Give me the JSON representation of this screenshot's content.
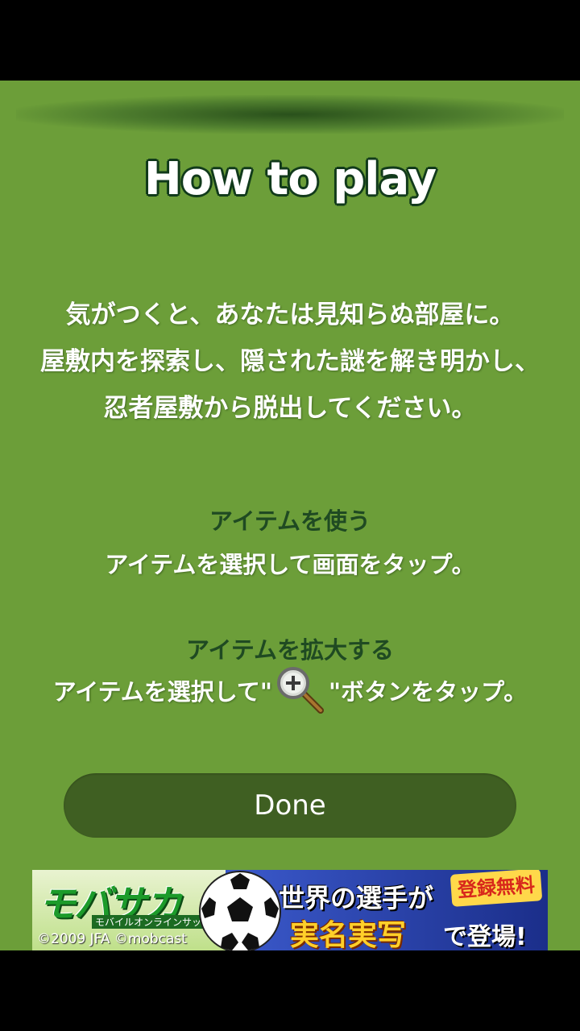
{
  "title": "How to play",
  "intro": {
    "line1": "気がつくと、あなたは見知らぬ部屋に。",
    "line2": "屋敷内を探索し、隠された謎を解き明かし、",
    "line3": "忍者屋敷から脱出してください。"
  },
  "use_item": {
    "heading": "アイテムを使う",
    "text": "アイテムを選択して画面をタップ。"
  },
  "zoom_item": {
    "heading": "アイテムを拡大する",
    "text_before": "アイテムを選択して\"",
    "text_after": "\"ボタンをタップ。",
    "icon": "magnifier-plus-icon"
  },
  "done_label": "Done",
  "ad": {
    "logo": "モバサカ",
    "sub": "モバイルオンラインサッカー",
    "copyright": "©2009 JFA ©mobcast",
    "line1": "世界の選手が",
    "badge": "登録無料",
    "line2": "実名実写",
    "line3": "で登場!"
  },
  "colors": {
    "background": "#6c9e39",
    "heading": "#1f4a22",
    "button": "#3f5f22"
  }
}
